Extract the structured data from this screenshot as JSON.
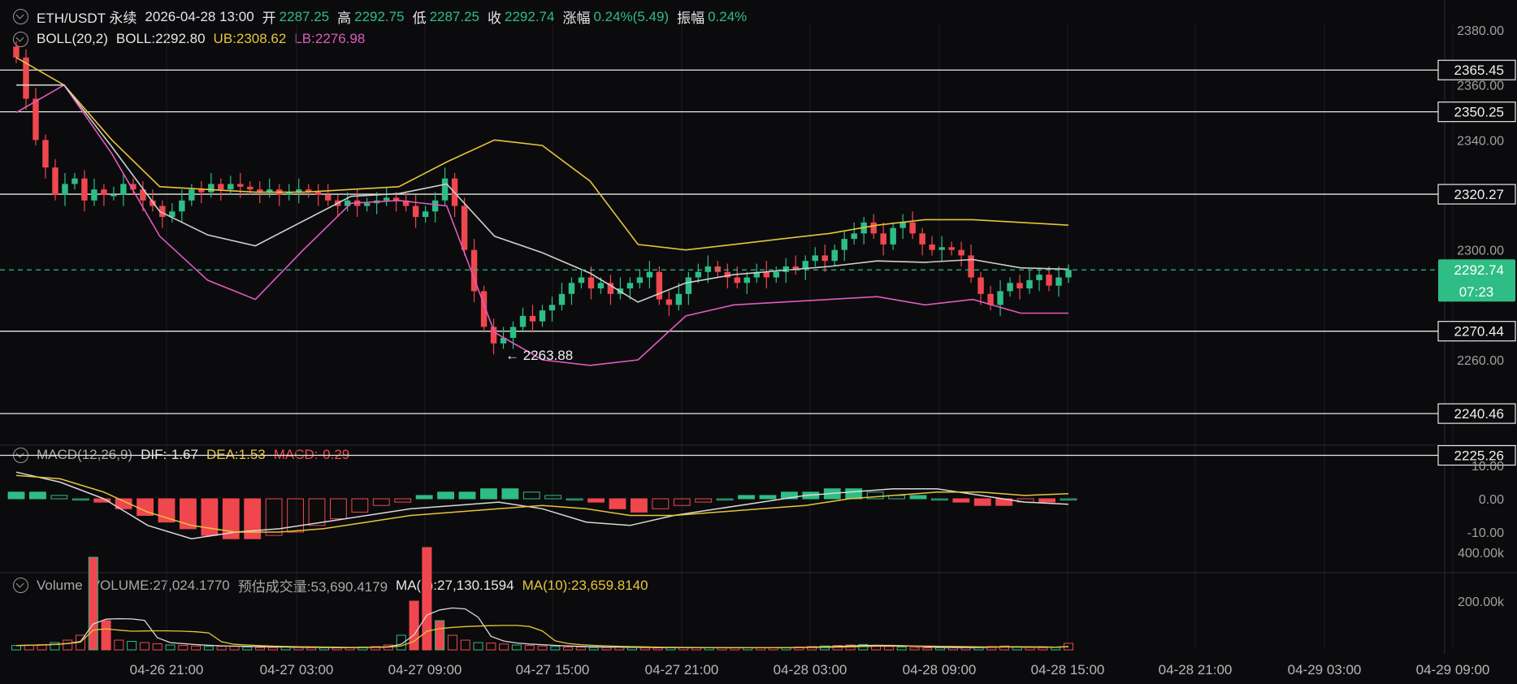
{
  "header": {
    "symbol": "ETH/USDT 永续",
    "datetime": "2026-04-28 13:00",
    "open_label": "开",
    "open_value": "2287.25",
    "high_label": "高",
    "high_value": "2292.75",
    "low_label": "低",
    "low_value": "2287.25",
    "close_label": "收",
    "close_value": "2292.74",
    "change_label": "涨幅",
    "change_value": "0.24%(5.49)",
    "amp_label": "振幅",
    "amp_value": "0.24%"
  },
  "boll": {
    "title": "BOLL(20,2)",
    "mid": "BOLL:2292.80",
    "ub": "UB:2308.62",
    "lb": "LB:2276.98"
  },
  "macd": {
    "title": "MACD(12,26,9)",
    "dif": "DIF:-1.67",
    "dea": "DEA:1.53",
    "macd": "MACD:-0.29"
  },
  "volume": {
    "title": "Volume",
    "vol": "VOLUME:27,024.1770",
    "est": "预估成交量:53,690.4179",
    "ma5": "MA(5):27,130.1594",
    "ma10": "MA(10):23,659.8140"
  },
  "colors": {
    "up": "#2ebd85",
    "down": "#f0474f",
    "ub": "#e7c53a",
    "lb": "#e05bbd",
    "mid": "#cfcfcf",
    "bg": "#0b0b0d"
  },
  "chart_data": [
    {
      "type": "candlestick",
      "title": "ETH/USDT 永续",
      "y_ticks": [
        "2380.00",
        "2360.00",
        "2340.00",
        "2300.00",
        "2260.00"
      ],
      "ylim": [
        2225,
        2382
      ],
      "x_ticks": [
        "04-26 21:00",
        "04-27 03:00",
        "04-27 09:00",
        "04-27 15:00",
        "04-27 21:00",
        "04-28 03:00",
        "04-28 09:00",
        "04-28 15:00",
        "04-28 21:00",
        "04-29 03:00",
        "04-29 09:00"
      ],
      "horizontal_levels": [
        "2365.45",
        "2350.25",
        "2320.27",
        "2270.44",
        "2240.46",
        "2225.26"
      ],
      "current_price": "2292.74",
      "countdown": "07:23",
      "low_annotation": "← 2263.88",
      "close_series": [
        2370,
        2355,
        2340,
        2330,
        2320,
        2324,
        2326,
        2318,
        2322,
        2320,
        2320,
        2324,
        2322,
        2318,
        2316,
        2312,
        2314,
        2318,
        2322,
        2321,
        2324,
        2322,
        2324,
        2323,
        2322,
        2321,
        2322,
        2320,
        2321,
        2322,
        2321,
        2320,
        2318,
        2316,
        2318,
        2316,
        2317,
        2318,
        2319,
        2318,
        2316,
        2312,
        2314,
        2318,
        2326,
        2316,
        2300,
        2285,
        2272,
        2266,
        2268,
        2272,
        2276,
        2274,
        2278,
        2280,
        2284,
        2288,
        2290,
        2286,
        2288,
        2284,
        2286,
        2288,
        2290,
        2292,
        2282,
        2280,
        2284,
        2290,
        2292,
        2294,
        2292,
        2290,
        2288,
        2290,
        2292,
        2290,
        2292,
        2294,
        2293,
        2296,
        2298,
        2296,
        2300,
        2304,
        2306,
        2310,
        2306,
        2302,
        2308,
        2310,
        2306,
        2302,
        2300,
        2301,
        2300,
        2298,
        2290,
        2284,
        2280,
        2285,
        2288,
        2286,
        2289,
        2291,
        2287,
        2290,
        2292.74
      ],
      "boll_ub_sample": [
        2370,
        2360,
        2340,
        2323,
        2322,
        2321,
        2321,
        2322,
        2323,
        2332,
        2340,
        2338,
        2325,
        2302,
        2300,
        2302,
        2304,
        2306,
        2309,
        2311,
        2311,
        2310,
        2309
      ],
      "boll_lb_sample": [
        2350,
        2360,
        2335,
        2305,
        2289,
        2282,
        2300,
        2317,
        2318,
        2316,
        2270,
        2260,
        2258,
        2260,
        2276,
        2280,
        2281,
        2282,
        2283,
        2280,
        2282,
        2277,
        2277
      ]
    },
    {
      "type": "bar",
      "title": "MACD(12,26,9)",
      "y_ticks": [
        "10.00",
        "0.00",
        "-10.00"
      ],
      "ylim": [
        -14,
        12
      ],
      "histogram": [
        2,
        2,
        1,
        0,
        -1,
        -3,
        -5,
        -7,
        -9,
        -11,
        -12,
        -12,
        -11,
        -10,
        -8,
        -6,
        -4,
        -2,
        -1,
        1,
        2,
        2,
        3,
        3,
        2,
        1,
        0,
        -1,
        -3,
        -4,
        -3,
        -2,
        -1,
        0,
        1,
        1,
        2,
        2,
        3,
        3,
        2,
        1,
        1,
        0,
        -1,
        -2,
        -2,
        -1,
        -1,
        0
      ],
      "dif_sample": [
        8,
        5,
        0,
        -8,
        -12,
        -10,
        -9,
        -7,
        -5,
        -3,
        -2,
        -1,
        -3,
        -7,
        -8,
        -5,
        -3,
        -1,
        1,
        2,
        3,
        3,
        1,
        -1,
        -1.67
      ],
      "dea_sample": [
        7,
        6,
        2,
        -4,
        -8,
        -10,
        -10,
        -9,
        -7,
        -5,
        -4,
        -3,
        -2,
        -3,
        -5,
        -5,
        -4,
        -3,
        -2,
        0,
        1,
        2,
        2,
        1,
        1.53
      ]
    },
    {
      "type": "bar",
      "title": "Volume",
      "y_ticks": [
        "400.00k",
        "200.00k"
      ],
      "ylim": [
        0,
        480
      ],
      "values_k": [
        18,
        20,
        22,
        30,
        40,
        60,
        380,
        120,
        40,
        35,
        30,
        25,
        20,
        18,
        16,
        14,
        15,
        14,
        12,
        10,
        10,
        12,
        10,
        9,
        9,
        8,
        10,
        12,
        14,
        20,
        60,
        200,
        420,
        120,
        60,
        40,
        30,
        28,
        24,
        20,
        18,
        16,
        14,
        12,
        12,
        10,
        10,
        12,
        10,
        9,
        8,
        9,
        10,
        10,
        9,
        8,
        8,
        9,
        10,
        9,
        10,
        12,
        14,
        16,
        18,
        20,
        22,
        18,
        14,
        12,
        10,
        8,
        9,
        10,
        12,
        10,
        14,
        16,
        12,
        10,
        9,
        10,
        27
      ]
    }
  ]
}
